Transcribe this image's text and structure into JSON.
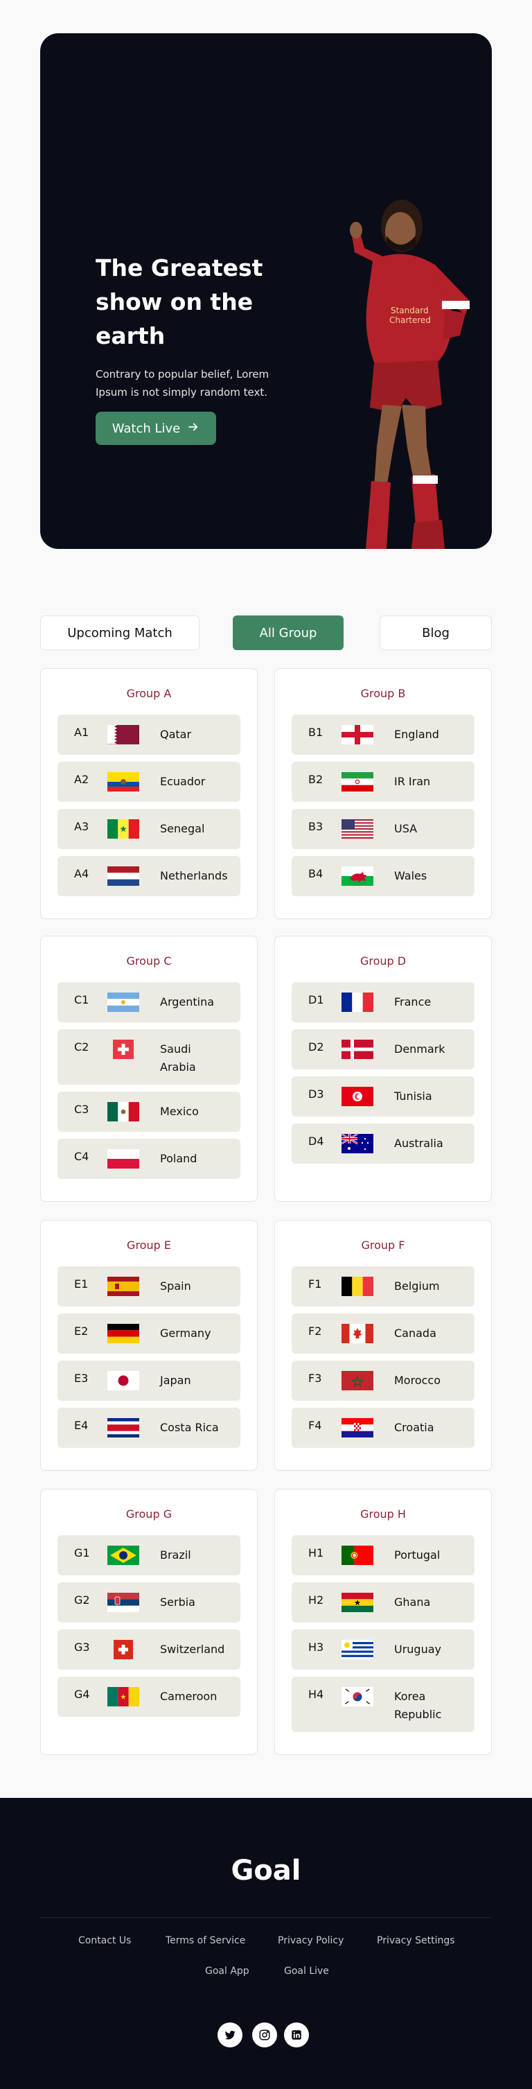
{
  "hero": {
    "title_line1": "The Greatest",
    "title_line2": "show on the",
    "title_line3": "earth",
    "subtitle": "Contrary to popular belief, Lorem Ipsum is not simply random text.",
    "cta_label": "Watch Live",
    "cta_icon": "arrow-right-icon"
  },
  "tabs": {
    "upcoming": "Upcoming Match",
    "all_group": "All Group",
    "blog": "Blog",
    "active": "All Group"
  },
  "groups": [
    {
      "title": "Group A",
      "teams": [
        {
          "code": "A1",
          "name": "Qatar",
          "flag": "qatar-flag-icon"
        },
        {
          "code": "A2",
          "name": "Ecuador",
          "flag": "ecuador-flag-icon"
        },
        {
          "code": "A3",
          "name": "Senegal",
          "flag": "senegal-flag-icon"
        },
        {
          "code": "A4",
          "name": "Netherlands",
          "flag": "netherlands-flag-icon"
        }
      ]
    },
    {
      "title": "Group B",
      "teams": [
        {
          "code": "B1",
          "name": "England",
          "flag": "england-flag-icon"
        },
        {
          "code": "B2",
          "name": "IR Iran",
          "flag": "iran-flag-icon"
        },
        {
          "code": "B3",
          "name": "USA",
          "flag": "usa-flag-icon"
        },
        {
          "code": "B4",
          "name": "Wales",
          "flag": "wales-flag-icon"
        }
      ]
    },
    {
      "title": "Group C",
      "teams": [
        {
          "code": "C1",
          "name": "Argentina",
          "flag": "argentina-flag-icon"
        },
        {
          "code": "C2",
          "name": "Saudi Arabia",
          "flag": "saudi-arabia-flag-icon"
        },
        {
          "code": "C3",
          "name": "Mexico",
          "flag": "mexico-flag-icon"
        },
        {
          "code": "C4",
          "name": "Poland",
          "flag": "poland-flag-icon"
        }
      ]
    },
    {
      "title": "Group D",
      "teams": [
        {
          "code": "D1",
          "name": "France",
          "flag": "france-flag-icon"
        },
        {
          "code": "D2",
          "name": "Denmark",
          "flag": "denmark-flag-icon"
        },
        {
          "code": "D3",
          "name": "Tunisia",
          "flag": "tunisia-flag-icon"
        },
        {
          "code": "D4",
          "name": "Australia",
          "flag": "australia-flag-icon"
        }
      ]
    },
    {
      "title": "Group E",
      "teams": [
        {
          "code": "E1",
          "name": "Spain",
          "flag": "spain-flag-icon"
        },
        {
          "code": "E2",
          "name": "Germany",
          "flag": "germany-flag-icon"
        },
        {
          "code": "E3",
          "name": "Japan",
          "flag": "japan-flag-icon"
        },
        {
          "code": "E4",
          "name": "Costa Rica",
          "flag": "costa-rica-flag-icon"
        }
      ]
    },
    {
      "title": "Group F",
      "teams": [
        {
          "code": "F1",
          "name": "Belgium",
          "flag": "belgium-flag-icon"
        },
        {
          "code": "F2",
          "name": "Canada",
          "flag": "canada-flag-icon"
        },
        {
          "code": "F3",
          "name": "Morocco",
          "flag": "morocco-flag-icon"
        },
        {
          "code": "F4",
          "name": "Croatia",
          "flag": "croatia-flag-icon"
        }
      ]
    },
    {
      "title": "Group G",
      "teams": [
        {
          "code": "G1",
          "name": "Brazil",
          "flag": "brazil-flag-icon"
        },
        {
          "code": "G2",
          "name": "Serbia",
          "flag": "serbia-flag-icon"
        },
        {
          "code": "G3",
          "name": "Switzerland",
          "flag": "switzerland-flag-icon"
        },
        {
          "code": "G4",
          "name": "Cameroon",
          "flag": "cameroon-flag-icon"
        }
      ]
    },
    {
      "title": "Group H",
      "teams": [
        {
          "code": "H1",
          "name": "Portugal",
          "flag": "portugal-flag-icon"
        },
        {
          "code": "H2",
          "name": "Ghana",
          "flag": "ghana-flag-icon"
        },
        {
          "code": "H3",
          "name": "Uruguay",
          "flag": "uruguay-flag-icon"
        },
        {
          "code": "H4",
          "name": "Korea Republic",
          "flag": "korea-flag-icon"
        }
      ]
    }
  ],
  "footer": {
    "logo": "Goal",
    "links": [
      "Contact Us",
      "Terms of Service",
      "Privacy Policy",
      "Privacy Settings",
      "Goal App",
      "Goal Live"
    ],
    "social": [
      "twitter-icon",
      "instagram-icon",
      "linkedin-icon"
    ]
  },
  "colors": {
    "dark_bg": "#0a0c17",
    "accent_green": "#3f8562",
    "group_title": "#8b2335",
    "row_bg": "#ecebe3"
  }
}
